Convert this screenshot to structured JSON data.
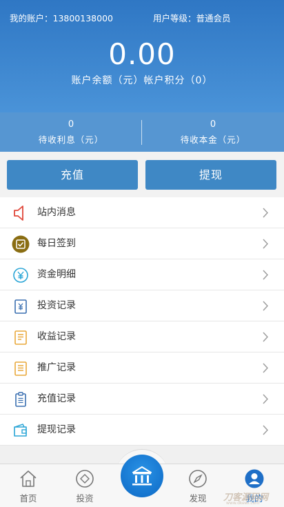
{
  "header": {
    "account_text": "我的账户：13800138000",
    "level_text": "用户等级：普通会员",
    "balance": "0.00",
    "balance_label": "账户余额（元）帐户积分（0）"
  },
  "stats": [
    {
      "value": "0",
      "label": "待收利息（元）"
    },
    {
      "value": "0",
      "label": "待收本金（元）"
    }
  ],
  "buttons": {
    "recharge": "充值",
    "withdraw": "提现"
  },
  "menu": [
    {
      "label": "站内消息",
      "icon": "speaker-icon"
    },
    {
      "label": "每日签到",
      "icon": "checkin-icon"
    },
    {
      "label": "资金明细",
      "icon": "yuan-icon"
    },
    {
      "label": "投资记录",
      "icon": "invest-record-icon"
    },
    {
      "label": "收益记录",
      "icon": "earnings-record-icon"
    },
    {
      "label": "推广记录",
      "icon": "promo-record-icon"
    },
    {
      "label": "充值记录",
      "icon": "clipboard-icon"
    },
    {
      "label": "提现记录",
      "icon": "wallet-icon"
    }
  ],
  "tabs": [
    {
      "label": "首页",
      "icon": "home-icon"
    },
    {
      "label": "投资",
      "icon": "diamond-icon"
    },
    {
      "label": "",
      "icon": "bank-icon"
    },
    {
      "label": "发现",
      "icon": "compass-icon"
    },
    {
      "label": "我的",
      "icon": "user-icon",
      "active": true
    }
  ],
  "watermark": {
    "text": "刀客源码网",
    "subtext": "www.dkewl.com"
  },
  "colors": {
    "header_blue": "#2f77c4",
    "button_blue": "#3f88c5",
    "active_tab": "#1f6fc7"
  }
}
